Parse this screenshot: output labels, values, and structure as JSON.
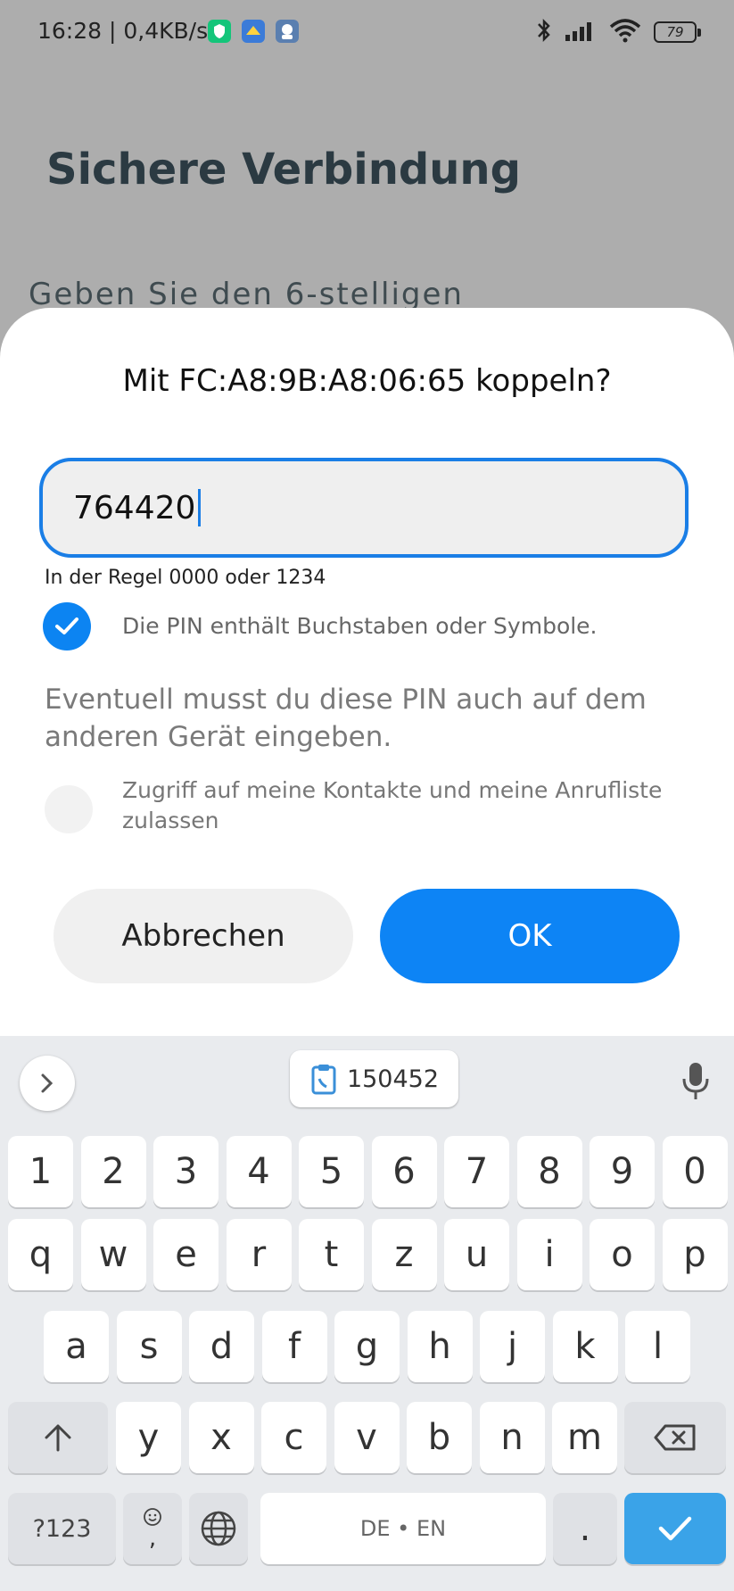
{
  "status_bar": {
    "time": "16:28 | 0,4KB/s",
    "battery": "79",
    "icons": [
      "shield-app-icon",
      "app-icon",
      "avatar-app-icon",
      "bluetooth-icon",
      "signal-icon",
      "wifi-icon",
      "battery-icon"
    ]
  },
  "background": {
    "title": "Sichere Verbindung",
    "subtitle": "Geben Sie den 6-stelligen"
  },
  "dialog": {
    "title": "Mit FC:A8:9B:A8:06:65 koppeln?",
    "pin_value": "764420",
    "hint": "In der Regel 0000 oder 1234",
    "letters_checkbox_label": "Die PIN enthält Buchstaben oder Symbole.",
    "letters_checked": true,
    "info": "Eventuell musst du diese PIN auch auf dem anderen Gerät eingeben.",
    "contacts_checkbox_label": "Zugriff auf meine Kontakte und meine Anrufliste zulassen",
    "contacts_checked": false,
    "cancel_label": "Abbrechen",
    "ok_label": "OK"
  },
  "keyboard": {
    "clipboard_suggestion": "150452",
    "row_numbers": [
      "1",
      "2",
      "3",
      "4",
      "5",
      "6",
      "7",
      "8",
      "9",
      "0"
    ],
    "row_1": [
      "q",
      "w",
      "e",
      "r",
      "t",
      "z",
      "u",
      "i",
      "o",
      "p"
    ],
    "row_2": [
      "a",
      "s",
      "d",
      "f",
      "g",
      "h",
      "j",
      "k",
      "l"
    ],
    "row_3": [
      "y",
      "x",
      "c",
      "v",
      "b",
      "n",
      "m"
    ],
    "symbols_label": "?123",
    "comma_label": ",",
    "space_label": "DE • EN",
    "period_label": ".",
    "colors": {
      "accent": "#0d84f5",
      "enter": "#3aa3e8"
    }
  }
}
